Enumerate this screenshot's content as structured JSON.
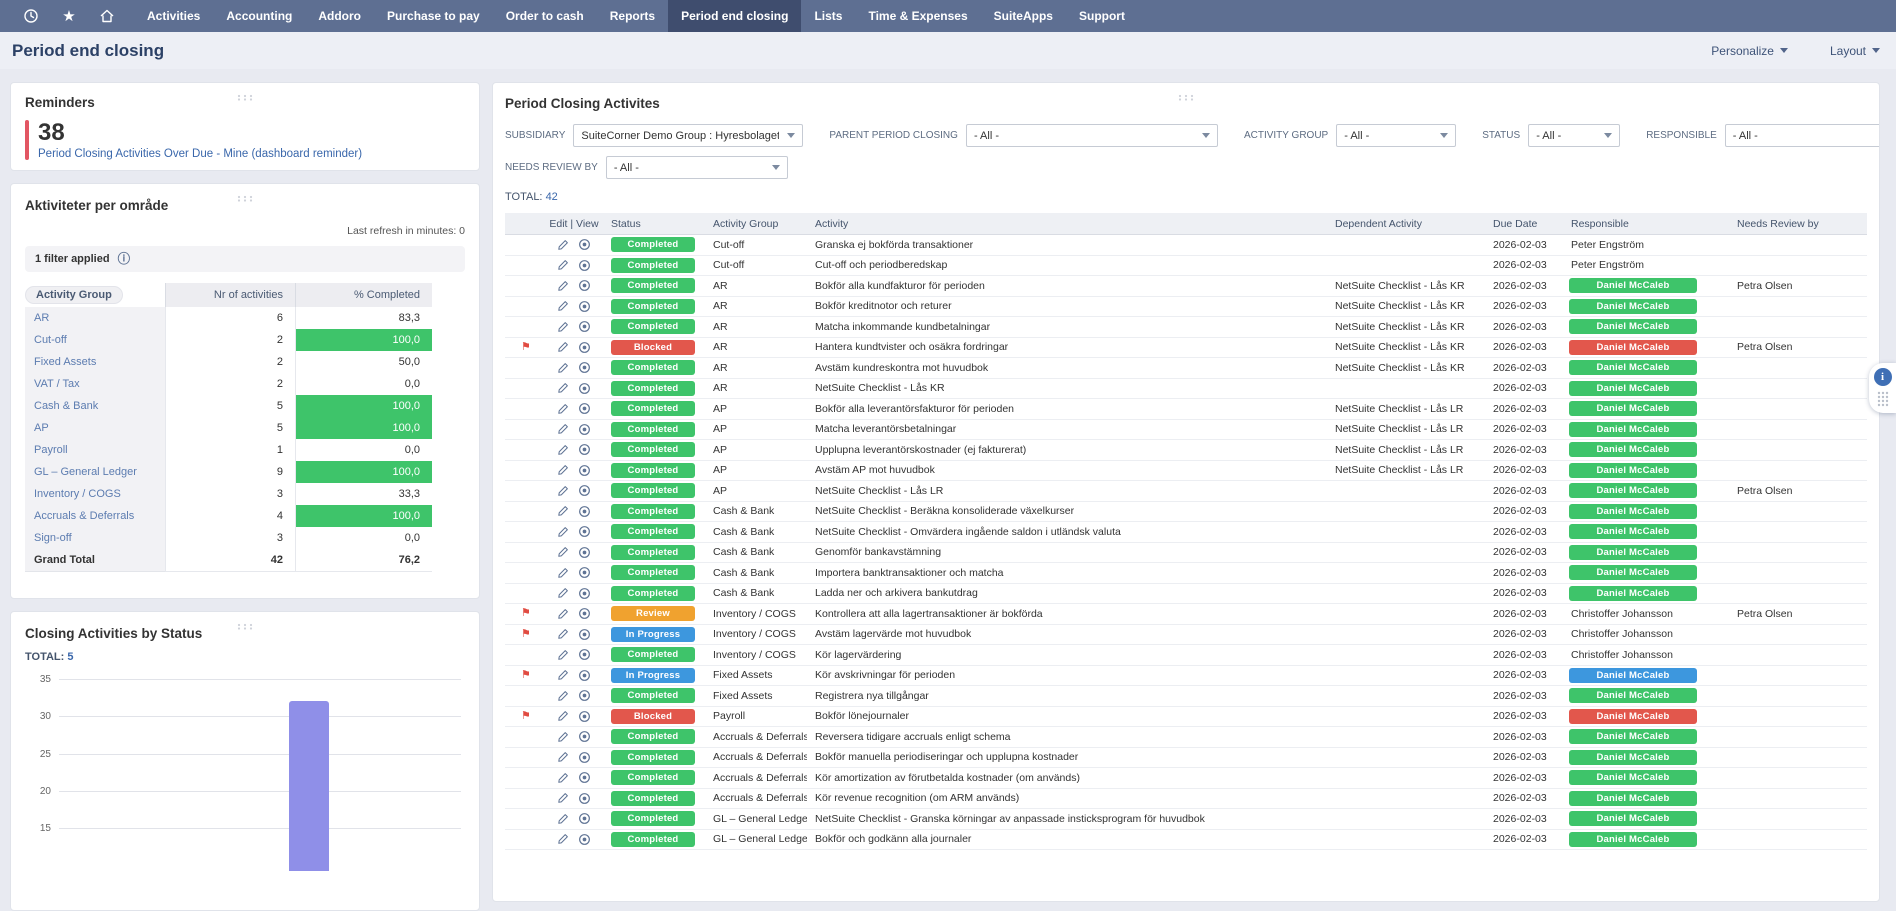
{
  "nav": {
    "items": [
      {
        "label": "Activities",
        "active": false
      },
      {
        "label": "Accounting",
        "active": false
      },
      {
        "label": "Addoro",
        "active": false
      },
      {
        "label": "Purchase to pay",
        "active": false
      },
      {
        "label": "Order to cash",
        "active": false
      },
      {
        "label": "Reports",
        "active": false
      },
      {
        "label": "Period end closing",
        "active": true
      },
      {
        "label": "Lists",
        "active": false
      },
      {
        "label": "Time & Expenses",
        "active": false
      },
      {
        "label": "SuiteApps",
        "active": false
      },
      {
        "label": "Support",
        "active": false
      }
    ]
  },
  "header": {
    "title": "Period end closing",
    "personalize_label": "Personalize",
    "layout_label": "Layout"
  },
  "reminders": {
    "title": "Reminders",
    "count": "38",
    "link": "Period Closing Activities Over Due - Mine (dashboard reminder)"
  },
  "areas": {
    "title": "Aktiviteter per område",
    "refresh_note": "Last refresh in minutes: 0",
    "filter_note": "1 filter applied",
    "columns": [
      "Activity Group",
      "Nr of activities",
      "% Completed"
    ],
    "rows": [
      {
        "group": "AR",
        "count": "6",
        "pct": "83,3",
        "filled": false,
        "total": false
      },
      {
        "group": "Cut-off",
        "count": "2",
        "pct": "100,0",
        "filled": true,
        "total": false
      },
      {
        "group": "Fixed Assets",
        "count": "2",
        "pct": "50,0",
        "filled": false,
        "total": false
      },
      {
        "group": "VAT / Tax",
        "count": "2",
        "pct": "0,0",
        "filled": false,
        "total": false
      },
      {
        "group": "Cash & Bank",
        "count": "5",
        "pct": "100,0",
        "filled": true,
        "total": false
      },
      {
        "group": "AP",
        "count": "5",
        "pct": "100,0",
        "filled": true,
        "total": false
      },
      {
        "group": "Payroll",
        "count": "1",
        "pct": "0,0",
        "filled": false,
        "total": false
      },
      {
        "group": "GL – General Ledger",
        "count": "9",
        "pct": "100,0",
        "filled": true,
        "total": false
      },
      {
        "group": "Inventory / COGS",
        "count": "3",
        "pct": "33,3",
        "filled": false,
        "total": false
      },
      {
        "group": "Accruals & Deferrals",
        "count": "4",
        "pct": "100,0",
        "filled": true,
        "total": false
      },
      {
        "group": "Sign-off",
        "count": "3",
        "pct": "0,0",
        "filled": false,
        "total": false
      },
      {
        "group": "Grand Total",
        "count": "42",
        "pct": "76,2",
        "filled": false,
        "total": true
      }
    ]
  },
  "status_chart": {
    "title": "Closing Activities by Status",
    "total_label": "TOTAL:",
    "total_value": "5",
    "chart_data": {
      "type": "bar",
      "title": "Closing Activities by Status",
      "categories": [
        ""
      ],
      "values": [
        32
      ],
      "yticks": [
        35,
        30,
        25,
        20,
        15
      ],
      "grid": true,
      "legend": false,
      "bar_color": "#8F8FE8",
      "bottom_cropped_by_viewport": true
    }
  },
  "main": {
    "title": "Period Closing Activites",
    "filters_row1": [
      {
        "id": "subsidiary",
        "label": "SUBSIDIARY",
        "value": "SuiteCorner Demo Group : Hyresbolaget"
      },
      {
        "id": "parent_period_closing",
        "label": "PARENT PERIOD CLOSING",
        "value": "- All -"
      },
      {
        "id": "activity_group",
        "label": "ACTIVITY GROUP",
        "value": "- All -"
      },
      {
        "id": "status",
        "label": "STATUS",
        "value": "- All -"
      },
      {
        "id": "responsible",
        "label": "RESPONSIBLE",
        "value": "- All -"
      }
    ],
    "filters_row2": [
      {
        "id": "needs_review_by",
        "label": "NEEDS REVIEW BY",
        "value": "- All -"
      }
    ],
    "total_label": "TOTAL:",
    "total_value": "42",
    "columns": [
      "",
      "Edit | View",
      "Status",
      "Activity Group",
      "Activity",
      "Dependent Activity",
      "Due Date",
      "Responsible",
      "Needs Review by"
    ],
    "rows": [
      {
        "flag": false,
        "status": "Completed",
        "group": "Cut-off",
        "activity": "Granska ej bokförda transaktioner",
        "dependent": "",
        "due": "2026-02-03",
        "resp": "Peter Engström",
        "badge": null,
        "review": ""
      },
      {
        "flag": false,
        "status": "Completed",
        "group": "Cut-off",
        "activity": "Cut-off och periodberedskap",
        "dependent": "",
        "due": "2026-02-03",
        "resp": "Peter Engström",
        "badge": null,
        "review": ""
      },
      {
        "flag": false,
        "status": "Completed",
        "group": "AR",
        "activity": "Bokför alla kundfakturor för perioden",
        "dependent": "NetSuite Checklist - Lås KR",
        "due": "2026-02-03",
        "resp": "Daniel McCaleb",
        "badge": "green",
        "review": "Petra Olsen"
      },
      {
        "flag": false,
        "status": "Completed",
        "group": "AR",
        "activity": "Bokför kreditnotor och returer",
        "dependent": "NetSuite Checklist - Lås KR",
        "due": "2026-02-03",
        "resp": "Daniel McCaleb",
        "badge": "green",
        "review": ""
      },
      {
        "flag": false,
        "status": "Completed",
        "group": "AR",
        "activity": "Matcha inkommande kundbetalningar",
        "dependent": "NetSuite Checklist - Lås KR",
        "due": "2026-02-03",
        "resp": "Daniel McCaleb",
        "badge": "green",
        "review": ""
      },
      {
        "flag": true,
        "status": "Blocked",
        "group": "AR",
        "activity": "Hantera kundtvister och osäkra fordringar",
        "dependent": "NetSuite Checklist - Lås KR",
        "due": "2026-02-03",
        "resp": "Daniel McCaleb",
        "badge": "red",
        "review": "Petra Olsen"
      },
      {
        "flag": false,
        "status": "Completed",
        "group": "AR",
        "activity": "Avstäm kundreskontra mot huvudbok",
        "dependent": "NetSuite Checklist - Lås KR",
        "due": "2026-02-03",
        "resp": "Daniel McCaleb",
        "badge": "green",
        "review": ""
      },
      {
        "flag": false,
        "status": "Completed",
        "group": "AR",
        "activity": "NetSuite Checklist - Lås KR",
        "dependent": "",
        "due": "2026-02-03",
        "resp": "Daniel McCaleb",
        "badge": "green",
        "review": ""
      },
      {
        "flag": false,
        "status": "Completed",
        "group": "AP",
        "activity": "Bokför alla leverantörsfakturor för perioden",
        "dependent": "NetSuite Checklist - Lås LR",
        "due": "2026-02-03",
        "resp": "Daniel McCaleb",
        "badge": "green",
        "review": ""
      },
      {
        "flag": false,
        "status": "Completed",
        "group": "AP",
        "activity": "Matcha leverantörsbetalningar",
        "dependent": "NetSuite Checklist - Lås LR",
        "due": "2026-02-03",
        "resp": "Daniel McCaleb",
        "badge": "green",
        "review": ""
      },
      {
        "flag": false,
        "status": "Completed",
        "group": "AP",
        "activity": "Upplupna leverantörskostnader (ej fakturerat)",
        "dependent": "NetSuite Checklist - Lås LR",
        "due": "2026-02-03",
        "resp": "Daniel McCaleb",
        "badge": "green",
        "review": ""
      },
      {
        "flag": false,
        "status": "Completed",
        "group": "AP",
        "activity": "Avstäm AP mot huvudbok",
        "dependent": "NetSuite Checklist - Lås LR",
        "due": "2026-02-03",
        "resp": "Daniel McCaleb",
        "badge": "green",
        "review": ""
      },
      {
        "flag": false,
        "status": "Completed",
        "group": "AP",
        "activity": "NetSuite Checklist - Lås LR",
        "dependent": "",
        "due": "2026-02-03",
        "resp": "Daniel McCaleb",
        "badge": "green",
        "review": "Petra Olsen"
      },
      {
        "flag": false,
        "status": "Completed",
        "group": "Cash & Bank",
        "activity": "NetSuite Checklist - Beräkna konsoliderade växelkurser",
        "dependent": "",
        "due": "2026-02-03",
        "resp": "Daniel McCaleb",
        "badge": "green",
        "review": ""
      },
      {
        "flag": false,
        "status": "Completed",
        "group": "Cash & Bank",
        "activity": "NetSuite Checklist - Omvärdera ingående saldon i utländsk valuta",
        "dependent": "",
        "due": "2026-02-03",
        "resp": "Daniel McCaleb",
        "badge": "green",
        "review": ""
      },
      {
        "flag": false,
        "status": "Completed",
        "group": "Cash & Bank",
        "activity": "Genomför bankavstämning",
        "dependent": "",
        "due": "2026-02-03",
        "resp": "Daniel McCaleb",
        "badge": "green",
        "review": ""
      },
      {
        "flag": false,
        "status": "Completed",
        "group": "Cash & Bank",
        "activity": "Importera banktransaktioner och matcha",
        "dependent": "",
        "due": "2026-02-03",
        "resp": "Daniel McCaleb",
        "badge": "green",
        "review": ""
      },
      {
        "flag": false,
        "status": "Completed",
        "group": "Cash & Bank",
        "activity": "Ladda ner och arkivera bankutdrag",
        "dependent": "",
        "due": "2026-02-03",
        "resp": "Daniel McCaleb",
        "badge": "green",
        "review": ""
      },
      {
        "flag": true,
        "status": "Review",
        "group": "Inventory / COGS",
        "activity": "Kontrollera att alla lagertransaktioner är bokförda",
        "dependent": "",
        "due": "2026-02-03",
        "resp": "Christoffer Johansson",
        "badge": null,
        "review": "Petra Olsen"
      },
      {
        "flag": true,
        "status": "In Progress",
        "group": "Inventory / COGS",
        "activity": "Avstäm lagervärde mot huvudbok",
        "dependent": "",
        "due": "2026-02-03",
        "resp": "Christoffer Johansson",
        "badge": null,
        "review": ""
      },
      {
        "flag": false,
        "status": "Completed",
        "group": "Inventory / COGS",
        "activity": "Kör lagervärdering",
        "dependent": "",
        "due": "2026-02-03",
        "resp": "Christoffer Johansson",
        "badge": null,
        "review": ""
      },
      {
        "flag": true,
        "status": "In Progress",
        "group": "Fixed Assets",
        "activity": "Kör avskrivningar för perioden",
        "dependent": "",
        "due": "2026-02-03",
        "resp": "Daniel McCaleb",
        "badge": "blue",
        "review": ""
      },
      {
        "flag": false,
        "status": "Completed",
        "group": "Fixed Assets",
        "activity": "Registrera nya tillgångar",
        "dependent": "",
        "due": "2026-02-03",
        "resp": "Daniel McCaleb",
        "badge": "green",
        "review": ""
      },
      {
        "flag": true,
        "status": "Blocked",
        "group": "Payroll",
        "activity": "Bokför lönejournaler",
        "dependent": "",
        "due": "2026-02-03",
        "resp": "Daniel McCaleb",
        "badge": "red",
        "review": ""
      },
      {
        "flag": false,
        "status": "Completed",
        "group": "Accruals & Deferrals",
        "activity": "Reversera tidigare accruals enligt schema",
        "dependent": "",
        "due": "2026-02-03",
        "resp": "Daniel McCaleb",
        "badge": "green",
        "review": ""
      },
      {
        "flag": false,
        "status": "Completed",
        "group": "Accruals & Deferrals",
        "activity": "Bokför manuella periodiseringar och upplupna kostnader",
        "dependent": "",
        "due": "2026-02-03",
        "resp": "Daniel McCaleb",
        "badge": "green",
        "review": ""
      },
      {
        "flag": false,
        "status": "Completed",
        "group": "Accruals & Deferrals",
        "activity": "Kör amortization av förutbetalda kostnader (om används)",
        "dependent": "",
        "due": "2026-02-03",
        "resp": "Daniel McCaleb",
        "badge": "green",
        "review": ""
      },
      {
        "flag": false,
        "status": "Completed",
        "group": "Accruals & Deferrals",
        "activity": "Kör revenue recognition (om ARM används)",
        "dependent": "",
        "due": "2026-02-03",
        "resp": "Daniel McCaleb",
        "badge": "green",
        "review": ""
      },
      {
        "flag": false,
        "status": "Completed",
        "group": "GL – General Ledger",
        "activity": "NetSuite Checklist - Granska körningar av anpassade insticksprogram för huvudbok",
        "dependent": "",
        "due": "2026-02-03",
        "resp": "Daniel McCaleb",
        "badge": "green",
        "review": ""
      },
      {
        "flag": false,
        "status": "Completed",
        "group": "GL – General Ledger",
        "activity": "Bokför och godkänn alla journaler",
        "dependent": "",
        "due": "2026-02-03",
        "resp": "Daniel McCaleb",
        "badge": "green",
        "review": ""
      }
    ]
  },
  "colors": {
    "green": "#3EC46A",
    "red": "#E2574C",
    "orange": "#F0A22F",
    "blue": "#3D97DE",
    "purple_bar": "#8F8FE8",
    "link": "#3A67AB",
    "nav": "#5E6F92",
    "nav_active": "#3F4D6E",
    "reminder_red": "#E25663",
    "flag": "#E14B41"
  }
}
